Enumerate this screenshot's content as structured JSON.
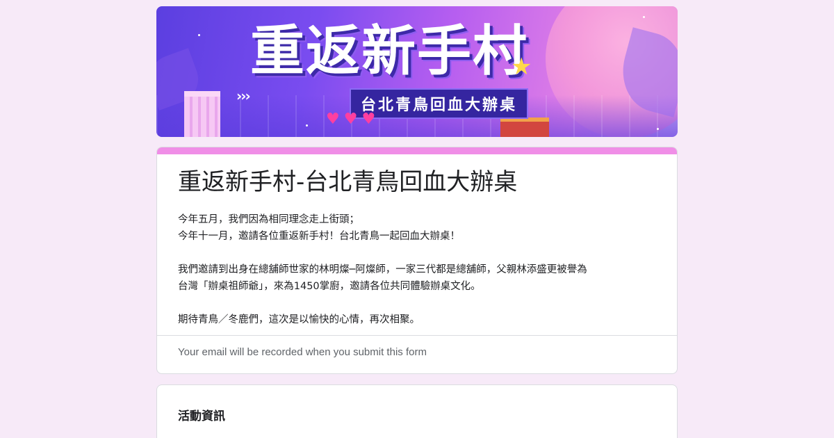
{
  "banner": {
    "image_alt": "重返新手村 台北青鳥回血大辦桌",
    "title_art": "重返新手村",
    "subtitle_art": "台北青鳥回血大辦桌",
    "arrows": "›››",
    "hearts": "♥♥♥",
    "star": "★"
  },
  "form": {
    "title": "重返新手村-台北青鳥回血大辦桌",
    "description": [
      "今年五月，我們因為相同理念走上街頭；",
      "今年十一月，邀請各位重返新手村！台北青鳥一起回血大辦桌！",
      "",
      "我們邀請到出身在總舖師世家的林明燦─阿燦師，一家三代都是總舖師，父親林添盛更被譽為",
      "台灣「辦桌祖師爺」，來為1450掌廚，邀請各位共同體驗辦桌文化。",
      "",
      "期待青鳥／冬鹿們，這次是以愉快的心情，再次相聚。"
    ],
    "email_note": "Your email will be recorded when you submit this form"
  },
  "section": {
    "title": "活動資訊"
  },
  "colors": {
    "page_bg": "#f7eaf8",
    "accent": "#f08ee7",
    "text": "#202124",
    "muted": "#5f6368"
  }
}
